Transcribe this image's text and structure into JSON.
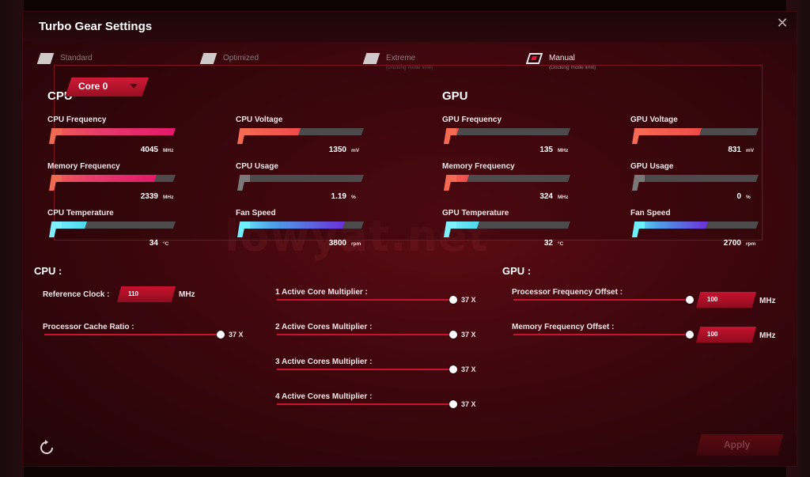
{
  "window": {
    "title": "Turbo Gear Settings",
    "close_glyph": "✕"
  },
  "modes": [
    {
      "label": "Standard",
      "sub": "",
      "active": false
    },
    {
      "label": "Optimized",
      "sub": "",
      "active": false
    },
    {
      "label": "Extreme",
      "sub": "(Docking mode limit)",
      "active": false
    },
    {
      "label": "Manual",
      "sub": "(Docking mode limit)",
      "active": true
    }
  ],
  "monitor": {
    "cpu": {
      "heading": "CPU",
      "core_selector": "Core 0",
      "metrics": [
        {
          "label": "CPU Frequency",
          "value": "4045",
          "unit": "MHz",
          "level": 1.0,
          "color": "pink"
        },
        {
          "label": "CPU Voltage",
          "value": "1350",
          "unit": "mV",
          "level": 0.5,
          "color": "red"
        },
        {
          "label": "Memory Frequency",
          "value": "2339",
          "unit": "MHz",
          "level": 0.85,
          "color": "pink"
        },
        {
          "label": "CPU Usage",
          "value": "1.19",
          "unit": "%",
          "level": 0.05,
          "color": "gray"
        },
        {
          "label": "CPU Temperature",
          "value": "34",
          "unit": "°C",
          "level": 0.3,
          "color": "cyan"
        },
        {
          "label": "Fan Speed",
          "value": "3800",
          "unit": "rpm",
          "level": 0.85,
          "color": "cyan-purple"
        }
      ]
    },
    "gpu": {
      "heading": "GPU",
      "metrics": [
        {
          "label": "GPU Frequency",
          "value": "135",
          "unit": "MHz",
          "level": 0.12,
          "color": "red"
        },
        {
          "label": "GPU Voltage",
          "value": "831",
          "unit": "mV",
          "level": 0.55,
          "color": "red"
        },
        {
          "label": "Memory Frequency",
          "value": "324",
          "unit": "MHz",
          "level": 0.2,
          "color": "red"
        },
        {
          "label": "GPU Usage",
          "value": "0",
          "unit": "%",
          "level": 0.0,
          "color": "gray"
        },
        {
          "label": "GPU Temperature",
          "value": "32",
          "unit": "°C",
          "level": 0.28,
          "color": "cyan"
        },
        {
          "label": "Fan Speed",
          "value": "2700",
          "unit": "rpm",
          "level": 0.6,
          "color": "cyan-purple"
        }
      ]
    }
  },
  "cpu_settings": {
    "heading": "CPU :",
    "reference_clock": {
      "label": "Reference Clock :",
      "value": "110",
      "unit": "MHz"
    },
    "cache_ratio": {
      "label": "Processor Cache Ratio :",
      "value": "37 X"
    },
    "multipliers": [
      {
        "label": "1 Active Core Multiplier :",
        "value": "37 X"
      },
      {
        "label": "2 Active Cores Multiplier :",
        "value": "37 X"
      },
      {
        "label": "3 Active Cores Multiplier :",
        "value": "37 X"
      },
      {
        "label": "4 Active Cores Multiplier :",
        "value": "37 X"
      }
    ]
  },
  "gpu_settings": {
    "heading": "GPU :",
    "freq_offset": {
      "label": "Processor Frequency Offset :",
      "value": "100",
      "unit": "MHz"
    },
    "mem_offset": {
      "label": "Memory Frequency Offset :",
      "value": "100",
      "unit": "MHz"
    }
  },
  "footer": {
    "apply_label": "Apply",
    "reset_icon": "refresh-icon"
  },
  "watermark": "lowyat.net",
  "colors": {
    "pink": "#e4186a",
    "red": "#ee4a4a",
    "cyan": "#4fd8ee",
    "purple": "#6b2fd8",
    "gray": "#5a5859",
    "accent": "#c8122f"
  }
}
